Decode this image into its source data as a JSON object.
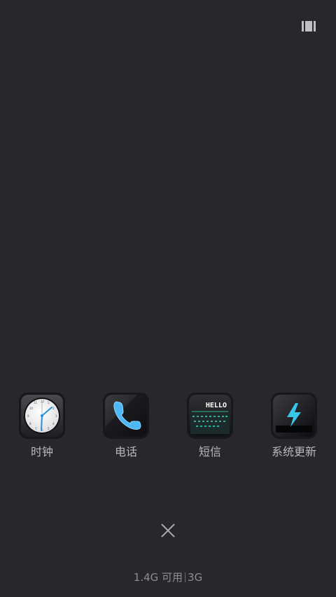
{
  "recents_screen": {
    "background": "#27282c",
    "apps": [
      {
        "label": "时钟",
        "icon": "clock-icon"
      },
      {
        "label": "电话",
        "icon": "phone-icon"
      },
      {
        "label": "短信",
        "icon": "messages-icon",
        "icon_text": "HELLO"
      },
      {
        "label": "系统更新",
        "icon": "system-update-icon"
      }
    ],
    "close_icon": "close-icon",
    "view_toggle_icon": "grid-view-icon",
    "memory": {
      "available": "1.4G 可用",
      "total": "3G"
    }
  }
}
